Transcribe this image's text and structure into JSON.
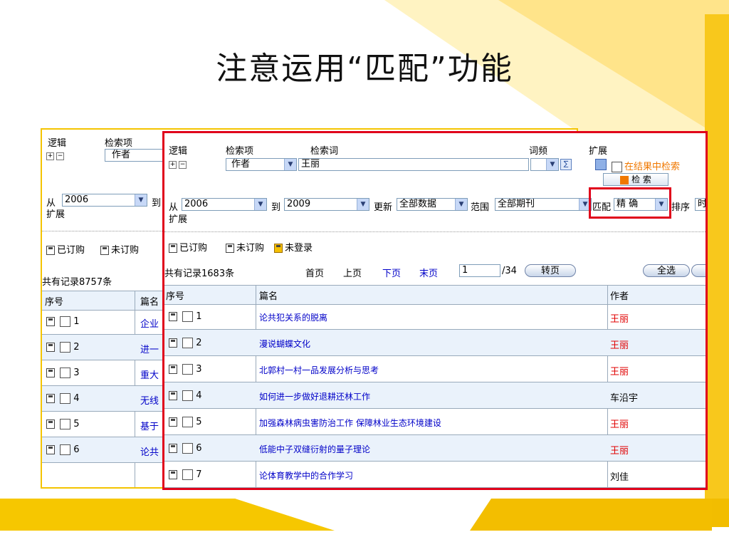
{
  "slide": {
    "title": "注意运用“匹配”功能"
  },
  "back": {
    "logic_label": "逻辑",
    "field_label": "检索项",
    "field_value": "作者",
    "from_label": "从",
    "from_year": "2006",
    "to_label": "到",
    "expand_label": "扩展",
    "legend_subscribed": "已订购",
    "legend_unsubscribed": "未订购",
    "record_count": "共有记录8757条",
    "col_no": "序号",
    "col_title": "篇名",
    "rows": [
      {
        "no": "1",
        "title": "企业"
      },
      {
        "no": "2",
        "title": "进一"
      },
      {
        "no": "3",
        "title": "重大"
      },
      {
        "no": "4",
        "title": "无线"
      },
      {
        "no": "5",
        "title": "基于"
      },
      {
        "no": "6",
        "title": "论共"
      }
    ]
  },
  "front": {
    "logic_label": "逻辑",
    "field_label": "检索项",
    "term_label": "检索词",
    "freq_label": "词频",
    "expand_label": "扩展",
    "field_value": "作者",
    "term_value": "王丽",
    "search_in_results": "在结果中检索",
    "search_button": "检 索",
    "from_label": "从",
    "from_year": "2006",
    "to_label": "到",
    "to_year": "2009",
    "update_label": "更新",
    "update_value": "全部数据",
    "range_label": "范围",
    "range_value": "全部期刊",
    "match_label": "匹配",
    "match_value": "精 确",
    "sort_label": "排序",
    "sort_value": "时",
    "expand_label2": "扩展",
    "legend_subscribed": "已订购",
    "legend_unsubscribed": "未订购",
    "legend_not_logged": "未登录",
    "record_count": "共有记录1683条",
    "first_page": "首页",
    "prev_page": "上页",
    "next_page": "下页",
    "last_page": "末页",
    "page_value": "1",
    "page_total": "/34",
    "goto_button": "转页",
    "select_all_button": "全选",
    "col_no": "序号",
    "col_title": "篇名",
    "col_author": "作者",
    "rows": [
      {
        "no": "1",
        "title": "论共犯关系的脱离",
        "author": "王丽",
        "author_color": "#e00000"
      },
      {
        "no": "2",
        "title": "漫说蝴蝶文化",
        "author": "王丽",
        "author_color": "#e00000"
      },
      {
        "no": "3",
        "title": "北郭村一村一品发展分析与思考",
        "author": "王丽",
        "author_color": "#e00000"
      },
      {
        "no": "4",
        "title": "如何进一步做好退耕还林工作",
        "author": "车沿宇",
        "author_color": "#000000"
      },
      {
        "no": "5",
        "title": "加强森林病虫害防治工作 保障林业生态环境建设",
        "author": "王丽",
        "author_color": "#e00000"
      },
      {
        "no": "6",
        "title": "低能中子双缝衍射的量子理论",
        "author": "王丽",
        "author_color": "#e00000"
      },
      {
        "no": "7",
        "title": "论体育教学中的合作学习",
        "author": "刘佳",
        "author_color": "#000000"
      }
    ]
  },
  "colors": {
    "highlight": "#e0001b",
    "accent": "#f4c400",
    "link": "#0000c8"
  }
}
